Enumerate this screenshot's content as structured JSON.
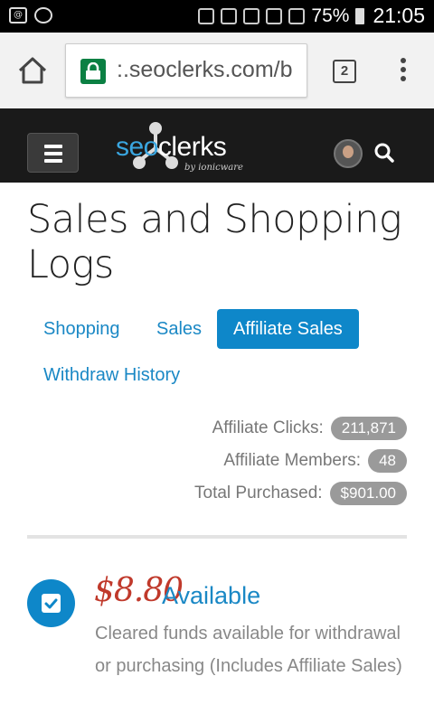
{
  "status_bar": {
    "battery_percent": "75%",
    "time": "21:05"
  },
  "browser": {
    "url": ":.seoclerks.com/b",
    "tab_count": "2",
    "icons": {
      "home": "home-icon",
      "lock": "lock-icon",
      "tabs": "tabs-icon",
      "menu": "overflow-menu-icon"
    },
    "lock_color": "#0b8043"
  },
  "site_header": {
    "logo_text_blue": "seo",
    "logo_text_white": "clerks",
    "logo_sub": "by ionicware",
    "icons": {
      "menu": "hamburger-icon",
      "search": "search-icon",
      "avatar": "avatar"
    }
  },
  "page": {
    "title": "Sales and Shopping Logs",
    "tabs": [
      {
        "label": "Shopping",
        "active": false
      },
      {
        "label": "Sales",
        "active": false
      },
      {
        "label": "Affiliate Sales",
        "active": true
      },
      {
        "label": "Withdraw History",
        "active": false
      }
    ],
    "stats": [
      {
        "label": "Affiliate Clicks:",
        "value": "211,871"
      },
      {
        "label": "Affiliate Members:",
        "value": "48"
      },
      {
        "label": "Total Purchased:",
        "value": "$901.00"
      }
    ],
    "funds": {
      "amount": "$8.80",
      "status": "Available",
      "description": "Cleared funds available for withdrawal or purchasing (Includes Affiliate Sales)",
      "icon": "checkbox-icon"
    }
  },
  "colors": {
    "accent": "#0e87c9",
    "amount_red": "#c0392b",
    "badge_gray": "#9a9a9a",
    "header_bg": "#1a1a1a"
  }
}
